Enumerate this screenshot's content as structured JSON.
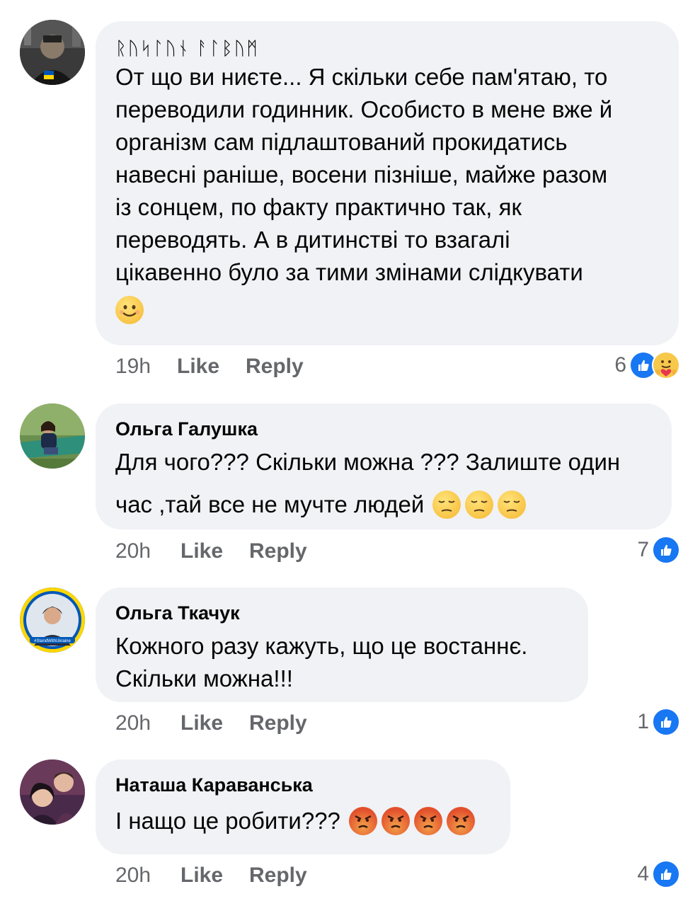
{
  "comments": [
    {
      "author": "ᚱᚢᛋᛚᚢᚾ ᚨᛚᛒᚢᛗ",
      "text_lines": [
        "От що ви ниєте... Я скільки себе пам'ятаю, то",
        "переводили годинник. Особисто в мене вже й",
        "організм сам підлаштований прокидатись",
        "навесні раніше, восени пізніше, майже разом",
        "із сонцем, по факту практично так, як",
        "переводять. А в дитинстві то взагалі",
        "цікавенно було за тими змінами слідкувати"
      ],
      "emoji": [
        "smiling-face"
      ],
      "time": "19h",
      "like_label": "Like",
      "reply_label": "Reply",
      "reaction_count": "6",
      "reactions": [
        "like",
        "care"
      ]
    },
    {
      "author": "Ольга Галушка",
      "text_lines": [
        "Для чого??? Скільки можна ??? Залиште один",
        "час ,тай все не мучте людей"
      ],
      "emoji": [
        "pensive-face",
        "pensive-face",
        "pensive-face"
      ],
      "time": "20h",
      "like_label": "Like",
      "reply_label": "Reply",
      "reaction_count": "7",
      "reactions": [
        "like"
      ]
    },
    {
      "author": "Ольга Ткачук",
      "text_lines": [
        "Кожного разу кажуть, що це востаннє.",
        "Скільки можна!!!"
      ],
      "emoji": [],
      "time": "20h",
      "like_label": "Like",
      "reply_label": "Reply",
      "reaction_count": "1",
      "reactions": [
        "like"
      ],
      "avatar_badge": "#StandWithUkraine"
    },
    {
      "author": "Наташа Караванська",
      "text_lines": [
        "І нащо це робити???"
      ],
      "emoji": [
        "angry-face",
        "angry-face",
        "angry-face",
        "angry-face"
      ],
      "time": "20h",
      "like_label": "Like",
      "reply_label": "Reply",
      "reaction_count": "4",
      "reactions": [
        "like"
      ]
    }
  ],
  "colors": {
    "bubble": "#f0f2f5",
    "meta_text": "#65676b",
    "like_blue": "#1877f2",
    "ukraine_blue": "#0057b7",
    "ukraine_yellow": "#ffd700"
  }
}
